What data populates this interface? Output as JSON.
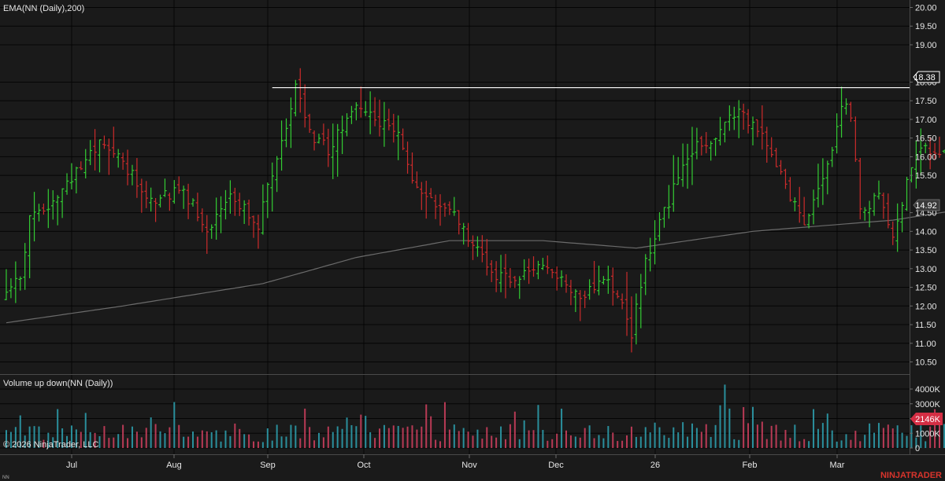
{
  "header": {
    "price_panel_title": "EMA(NN (Daily),200)",
    "volume_panel_title": "Volume up down(NN (Daily))"
  },
  "footer": {
    "copyright": "© 2026 NinjaTrader, LLC",
    "corner_label": "NN",
    "brand": "NINJATRADER"
  },
  "colors": {
    "background": "#1a1a1a",
    "up": "#33cc33",
    "down": "#cc2b2b",
    "vol_up": "#2a8f9c",
    "vol_down": "#b83a55",
    "ema": "#6b6b6b",
    "resistance": "#ffffff",
    "grid": "#000000"
  },
  "markers": {
    "last_price": "18.38",
    "ema_value": "14.92",
    "last_volume": "2146K"
  },
  "chart_data": [
    {
      "type": "ohlc",
      "title": "EMA(NN (Daily),200)",
      "x_labels": [
        "Jul",
        "Aug",
        "Sep",
        "Oct",
        "Nov",
        "Dec",
        "26",
        "Feb",
        "Mar"
      ],
      "y_ticks": [
        "10.50",
        "11.00",
        "11.50",
        "12.00",
        "12.50",
        "13.00",
        "13.50",
        "14.00",
        "14.50",
        "15.50",
        "16.00",
        "16.50",
        "17.00",
        "17.50",
        "18.00",
        "19.00",
        "19.50",
        "20.00"
      ],
      "ylim": [
        10.3,
        20.2
      ],
      "last_price": 18.38,
      "resistance_level": 17.85,
      "ema_value": 14.92,
      "ema_anchors": [
        [
          0,
          11.55
        ],
        [
          25,
          12.0
        ],
        [
          55,
          12.6
        ],
        [
          75,
          13.3
        ],
        [
          95,
          13.75
        ],
        [
          115,
          13.75
        ],
        [
          135,
          13.55
        ],
        [
          160,
          14.0
        ],
        [
          190,
          14.3
        ],
        [
          222,
          14.92
        ]
      ],
      "anchors": [
        [
          0,
          12.5
        ],
        [
          3,
          12.7
        ],
        [
          5,
          14.3
        ],
        [
          10,
          14.8
        ],
        [
          20,
          16.4
        ],
        [
          25,
          15.9
        ],
        [
          30,
          14.8
        ],
        [
          38,
          15.1
        ],
        [
          43,
          14.1
        ],
        [
          48,
          14.9
        ],
        [
          54,
          14.2
        ],
        [
          58,
          16.0
        ],
        [
          62,
          17.8
        ],
        [
          66,
          16.5
        ],
        [
          69,
          16.2
        ],
        [
          74,
          17.3
        ],
        [
          79,
          17.1
        ],
        [
          84,
          16.5
        ],
        [
          88,
          15.2
        ],
        [
          92,
          14.6
        ],
        [
          96,
          14.5
        ],
        [
          100,
          13.6
        ],
        [
          104,
          12.9
        ],
        [
          108,
          12.7
        ],
        [
          112,
          12.9
        ],
        [
          116,
          13.0
        ],
        [
          119,
          12.7
        ],
        [
          123,
          12.2
        ],
        [
          127,
          12.7
        ],
        [
          131,
          12.4
        ],
        [
          134,
          11.3
        ],
        [
          137,
          13.2
        ],
        [
          140,
          14.2
        ],
        [
          144,
          15.4
        ],
        [
          148,
          16.3
        ],
        [
          152,
          16.6
        ],
        [
          156,
          17.2
        ],
        [
          160,
          16.9
        ],
        [
          163,
          16.4
        ],
        [
          167,
          15.1
        ],
        [
          171,
          14.3
        ],
        [
          175,
          15.3
        ],
        [
          179,
          17.3
        ],
        [
          181,
          17.2
        ],
        [
          183,
          14.5
        ],
        [
          187,
          14.9
        ],
        [
          190,
          13.8
        ],
        [
          193,
          15.3
        ],
        [
          196,
          16.4
        ],
        [
          200,
          16.1
        ],
        [
          204,
          16.9
        ],
        [
          208,
          16.1
        ],
        [
          212,
          16.4
        ],
        [
          216,
          16.0
        ],
        [
          219,
          16.8
        ],
        [
          221,
          17.8
        ],
        [
          222,
          18.4
        ]
      ],
      "series": [
        {
          "name": "NN (Daily)",
          "bars": 223
        }
      ]
    },
    {
      "type": "bar",
      "title": "Volume up down(NN (Daily))",
      "y_ticks": [
        "0",
        "1000K",
        "2000K",
        "3000K",
        "4000K"
      ],
      "ylim": [
        0,
        4800
      ],
      "last_value": 2146,
      "units": "K"
    }
  ]
}
